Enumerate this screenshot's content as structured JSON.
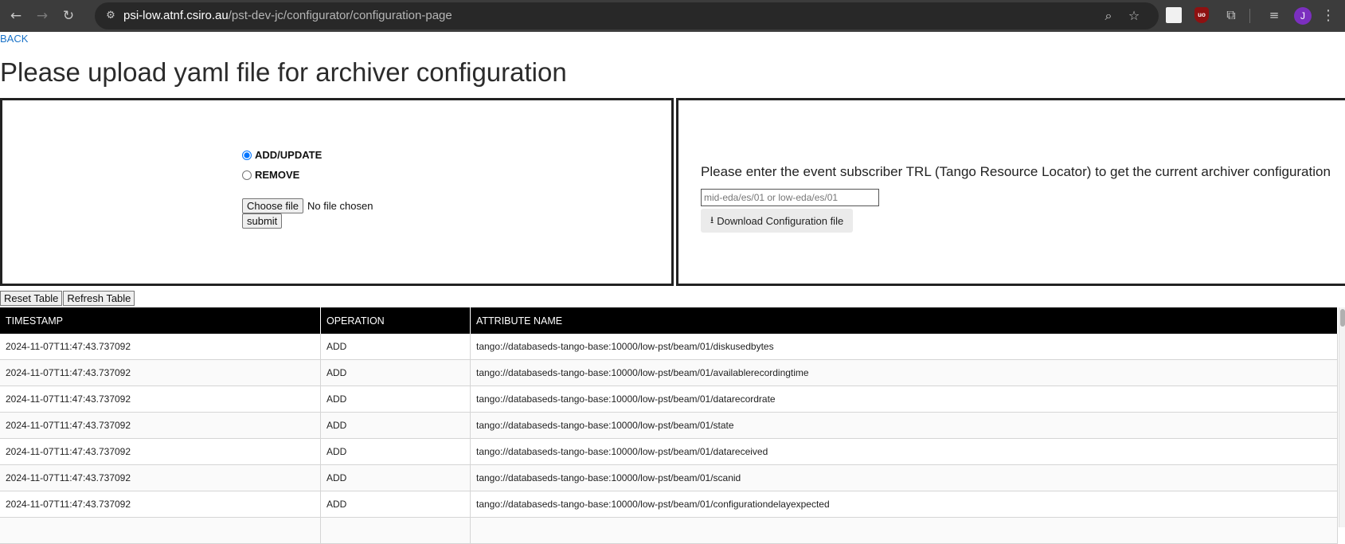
{
  "browser": {
    "back_icon": "←",
    "forward_icon": "→",
    "reload_icon": "↻",
    "site_info_icon": "⚙",
    "url_host": "psi-low.atnf.csiro.au",
    "url_path": "/pst-dev-jc/configurator/configuration-page",
    "zoom_icon": "⌕",
    "bookmark_icon": "☆",
    "puzzle_icon": "⧉",
    "media_icon": "≡",
    "ublock_label": "uo",
    "profile_initial": "J",
    "menu_icon": "⋮"
  },
  "page": {
    "back_label": "BACK",
    "title": "Please upload yaml file for archiver configuration"
  },
  "upload_panel": {
    "add_update_label": "ADD/UPDATE",
    "remove_label": "REMOVE",
    "selected_operation": "ADD/UPDATE",
    "choose_file_label": "Choose file",
    "file_status": "No file chosen",
    "submit_label": "submit"
  },
  "download_panel": {
    "instruction": "Please enter the event subscriber TRL (Tango Resource Locator) to get the current archiver configuration",
    "trl_placeholder": "mid-eda/es/01 or low-eda/es/01",
    "download_icon": "⭳",
    "download_label": "Download Configuration file"
  },
  "table_controls": {
    "reset_label": "Reset Table",
    "refresh_label": "Refresh Table"
  },
  "table": {
    "headers": [
      "TIMESTAMP",
      "OPERATION",
      "ATTRIBUTE NAME"
    ],
    "rows": [
      [
        "2024-11-07T11:47:43.737092",
        "ADD",
        "tango://databaseds-tango-base:10000/low-pst/beam/01/diskusedbytes"
      ],
      [
        "2024-11-07T11:47:43.737092",
        "ADD",
        "tango://databaseds-tango-base:10000/low-pst/beam/01/availablerecordingtime"
      ],
      [
        "2024-11-07T11:47:43.737092",
        "ADD",
        "tango://databaseds-tango-base:10000/low-pst/beam/01/datarecordrate"
      ],
      [
        "2024-11-07T11:47:43.737092",
        "ADD",
        "tango://databaseds-tango-base:10000/low-pst/beam/01/state"
      ],
      [
        "2024-11-07T11:47:43.737092",
        "ADD",
        "tango://databaseds-tango-base:10000/low-pst/beam/01/datareceived"
      ],
      [
        "2024-11-07T11:47:43.737092",
        "ADD",
        "tango://databaseds-tango-base:10000/low-pst/beam/01/scanid"
      ],
      [
        "2024-11-07T11:47:43.737092",
        "ADD",
        "tango://databaseds-tango-base:10000/low-pst/beam/01/configurationdelayexpected"
      ],
      [
        "",
        "",
        ""
      ]
    ]
  }
}
